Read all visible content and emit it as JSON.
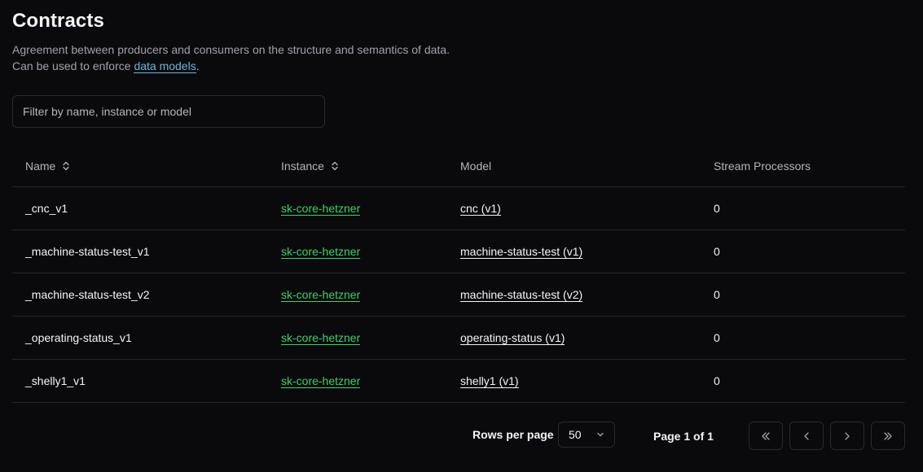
{
  "header": {
    "title": "Contracts",
    "description_line1": "Agreement between producers and consumers on the structure and semantics of data.",
    "description_line2_prefix": "Can be used to enforce ",
    "description_link": "data models",
    "description_line2_suffix": "."
  },
  "filter": {
    "placeholder": "Filter by name, instance or model",
    "value": ""
  },
  "table": {
    "columns": {
      "name": "Name",
      "instance": "Instance",
      "model": "Model",
      "stream_processors": "Stream Processors"
    },
    "rows": [
      {
        "name": "_cnc_v1",
        "instance": "sk-core-hetzner",
        "model": "cnc (v1)",
        "stream_processors": "0"
      },
      {
        "name": "_machine-status-test_v1",
        "instance": "sk-core-hetzner",
        "model": "machine-status-test (v1)",
        "stream_processors": "0"
      },
      {
        "name": "_machine-status-test_v2",
        "instance": "sk-core-hetzner",
        "model": "machine-status-test (v2)",
        "stream_processors": "0"
      },
      {
        "name": "_operating-status_v1",
        "instance": "sk-core-hetzner",
        "model": "operating-status (v1)",
        "stream_processors": "0"
      },
      {
        "name": "_shelly1_v1",
        "instance": "sk-core-hetzner",
        "model": "shelly1 (v1)",
        "stream_processors": "0"
      }
    ]
  },
  "pagination": {
    "rows_per_page_label": "Rows per page",
    "rows_per_page_value": "50",
    "page_info": "Page 1 of 1"
  },
  "icons": {
    "sort": "sort-icon",
    "select": "chevron-down-icon",
    "first": "chevrons-left-icon",
    "prev": "chevron-left-icon",
    "next": "chevron-right-icon",
    "last": "chevrons-right-icon"
  },
  "colors": {
    "background": "#0a0a0c",
    "instance_link": "#3ecf6b",
    "doc_link": "#6fb3d9",
    "border": "#26262a"
  }
}
